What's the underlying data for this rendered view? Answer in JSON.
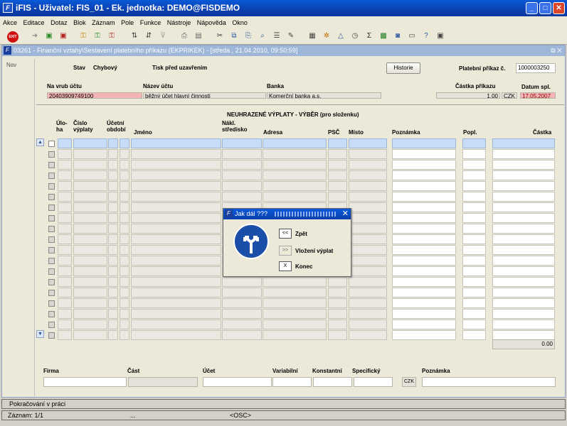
{
  "window": {
    "title": "iFIS - Uživatel: FIS_01 - Ek. jednotka: DEMO@FISDEMO",
    "minimize": "_",
    "maximize": "□",
    "close": "✕"
  },
  "menu": [
    "Akce",
    "Editace",
    "Dotaz",
    "Blok",
    "Záznam",
    "Pole",
    "Funkce",
    "Nástroje",
    "Nápověda",
    "Okno"
  ],
  "toolbar": {
    "exit_label": "EXIT"
  },
  "form": {
    "title": "03261 - Finanční vztahy\\Sestavení platebního příkazu (EKPRIKEK) - [středa , 21.04.2010, 09:50:59]",
    "window_controls": "⧉ ✕",
    "nav_label": "Nav",
    "stav_label": "Stav",
    "stav_value": "Chybový",
    "tisk_label": "Tisk před uzavřením",
    "historie_button": "Historie",
    "prikaz_label": "Platební příkaz č.",
    "prikaz_value": "1000003250",
    "na_vrub_label": "Na vrub účtu",
    "na_vrub_value": "20403909749100",
    "nazev_label": "Název účtu",
    "nazev_value": "běžný účet hlavní činnosti",
    "banka_label": "Banka",
    "banka_value": "Komerční banka a.s.",
    "castka_label": "Částka příkazu",
    "castka_value": "1,00",
    "mena_value": "CZK",
    "datum_label": "Datum spl.",
    "datum_value": "17.05.2007"
  },
  "grid": {
    "title": "NEUHRAZENÉ VÝPLATY - VÝBĚR (pro složenku)",
    "headers": {
      "uloha": "Úlo-\nha",
      "cislo": "Číslo\nvýplaty",
      "obdobi": "Účetní\nobdobí",
      "jmeno": "Jméno",
      "nakl": "Nákl.\nstředisko",
      "adresa": "Adresa",
      "psc": "PSČ",
      "misto": "Místo",
      "poznamka": "Poznámka",
      "popl": "Popl.",
      "castka": "Částka"
    },
    "total": "0.00",
    "rows": 19
  },
  "bottom": {
    "firma": "Firma",
    "cast": "Část",
    "ucet": "Účet",
    "variabilni": "Variabilní",
    "konstantni": "Konstantní",
    "specificky": "Specifický",
    "mena": "CZK",
    "poznamka": "Poznámka"
  },
  "dialog": {
    "title": "Jak dál ???",
    "close": "✕",
    "back_btn": "<<",
    "back_label": "Zpět",
    "insert_btn": ">>",
    "insert_label": "Vložení výplat",
    "end_btn": "X",
    "end_label": "Konec"
  },
  "status": {
    "line1": "Pokračování v práci",
    "record": "Záznam: 1/1",
    "dots": "...",
    "osc": "<OSC>"
  }
}
